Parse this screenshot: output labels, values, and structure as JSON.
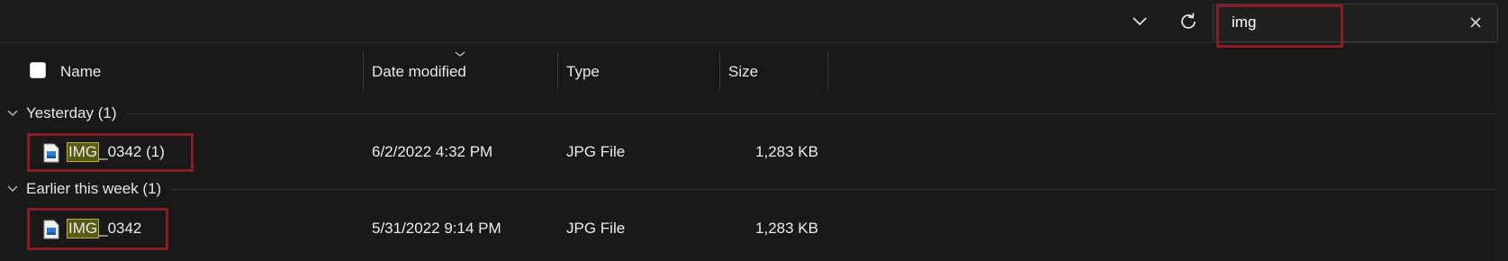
{
  "search": {
    "value": "img"
  },
  "columns": {
    "name": "Name",
    "date_modified": "Date modified",
    "type": "Type",
    "size": "Size"
  },
  "groups": [
    {
      "label": "Yesterday (1)",
      "files": [
        {
          "name_match": "IMG",
          "name_rest": "_0342 (1)",
          "date": "6/2/2022 4:32 PM",
          "type": "JPG File",
          "size": "1,283 KB"
        }
      ]
    },
    {
      "label": "Earlier this week (1)",
      "files": [
        {
          "name_match": "IMG",
          "name_rest": "_0342",
          "date": "5/31/2022 9:14 PM",
          "type": "JPG File",
          "size": "1,283 KB"
        }
      ]
    }
  ],
  "icons": {
    "expand": "chevron-down-icon",
    "refresh": "refresh-icon",
    "clear": "close-icon",
    "sort": "sort-indicator-icon",
    "group_toggle": "chevron-down-icon",
    "file": "image-file-icon"
  },
  "colors": {
    "annotation": "#8a1c26",
    "match_highlight": "#5a5a17",
    "background": "#191919"
  }
}
